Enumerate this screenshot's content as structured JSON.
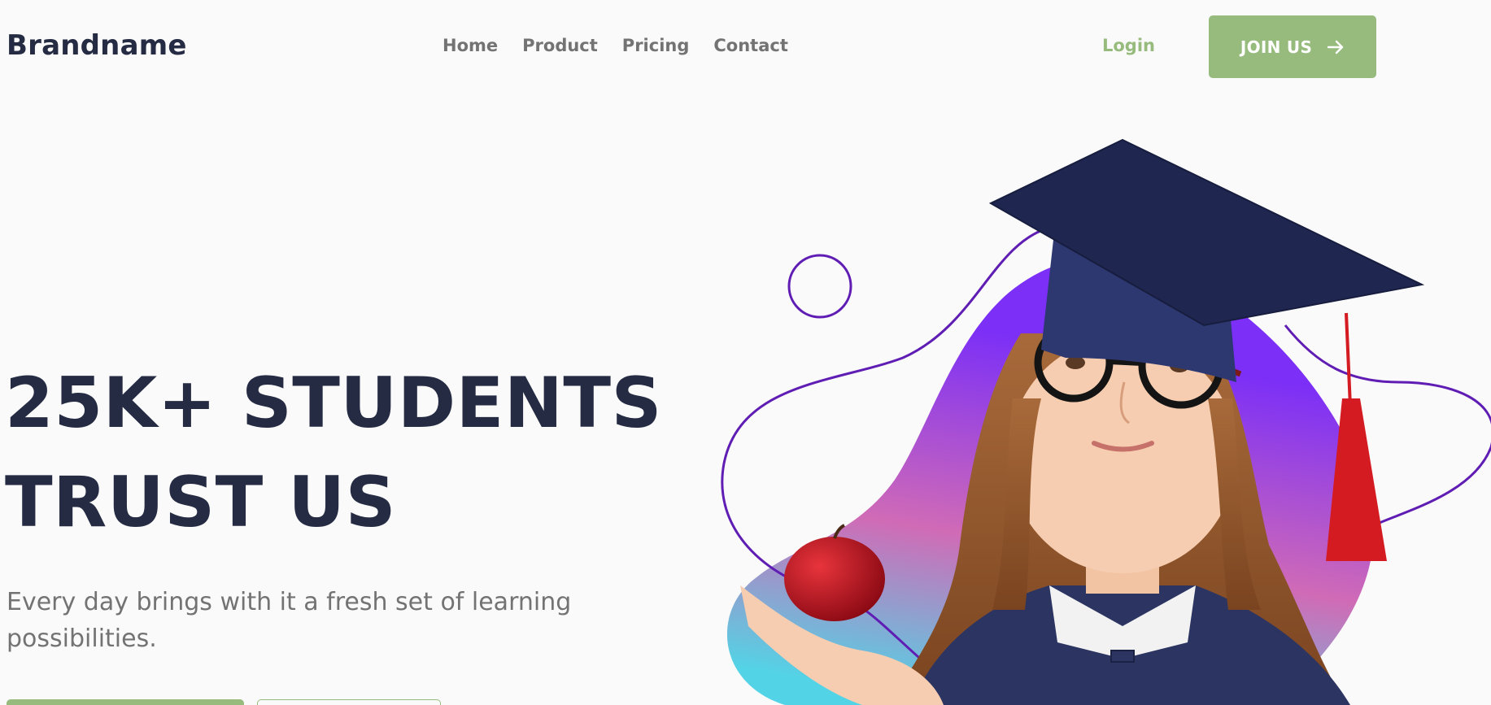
{
  "header": {
    "brand": "Brandname",
    "nav": [
      "Home",
      "Product",
      "Pricing",
      "Contact"
    ],
    "login_label": "Login",
    "join_label": "JOIN US"
  },
  "hero": {
    "title_line1": "25K+ STUDENTS",
    "title_line2": "TRUST US",
    "subtitle": "Every day brings with it a fresh set of learning possibilities."
  },
  "icons": {
    "join_icon": "arrow-right-icon",
    "decor_circle": "outline-circle-icon"
  },
  "colors": {
    "brand_text": "#252b42",
    "muted_text": "#737373",
    "accent_green": "#96bb7c",
    "accent_purple": "#5f1db4",
    "blob_gradient": [
      "#7b2ff7",
      "#d06bb6",
      "#53d3e6"
    ]
  }
}
